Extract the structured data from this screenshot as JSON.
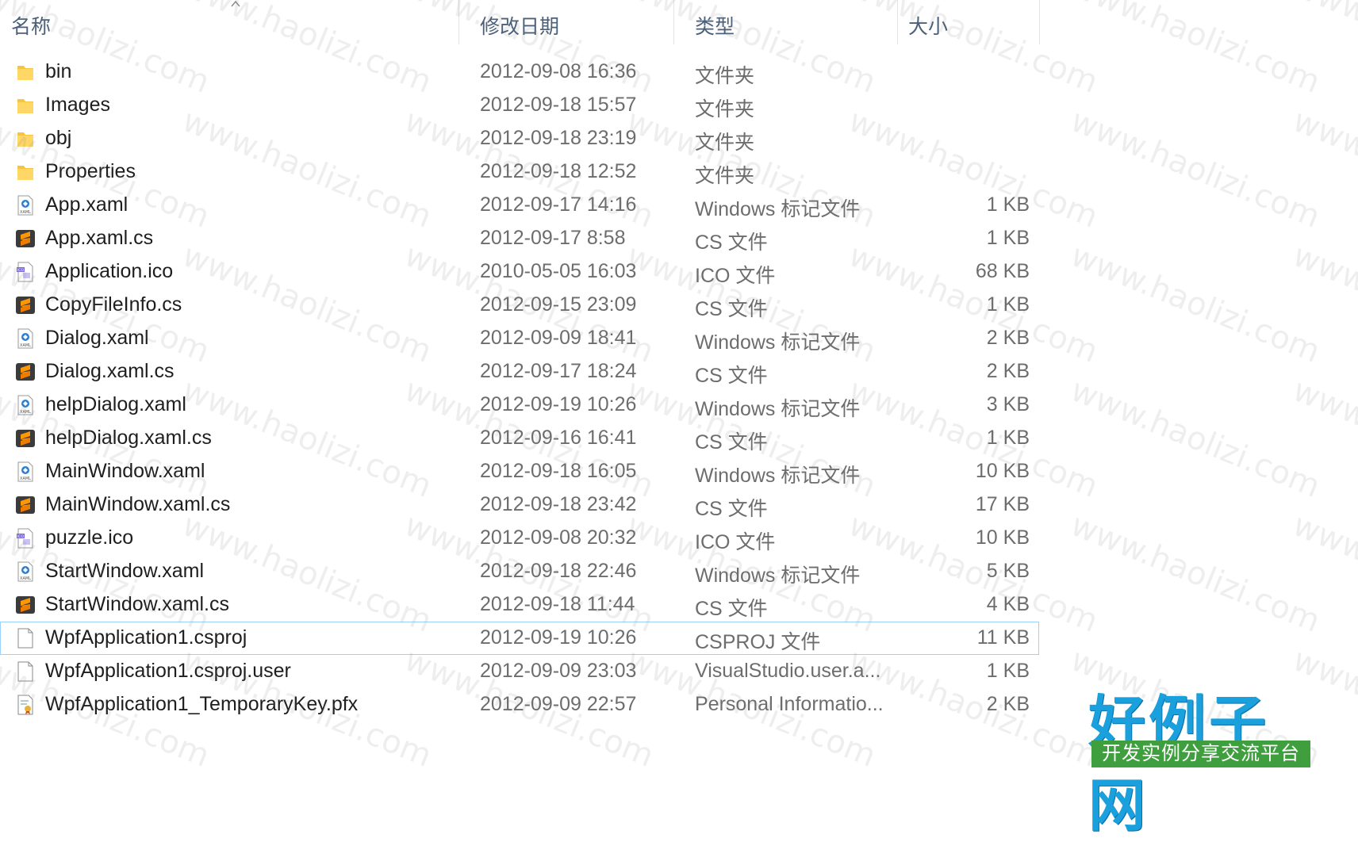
{
  "header": {
    "name_label": "名称",
    "date_label": "修改日期",
    "type_label": "类型",
    "size_label": "大小"
  },
  "files": [
    {
      "name": "bin",
      "date": "2012-09-08 16:36",
      "type": "文件夹",
      "size": "",
      "icon": "folder-icon"
    },
    {
      "name": "Images",
      "date": "2012-09-18 15:57",
      "type": "文件夹",
      "size": "",
      "icon": "folder-icon"
    },
    {
      "name": "obj",
      "date": "2012-09-18 23:19",
      "type": "文件夹",
      "size": "",
      "icon": "folder-icon"
    },
    {
      "name": "Properties",
      "date": "2012-09-18 12:52",
      "type": "文件夹",
      "size": "",
      "icon": "folder-icon"
    },
    {
      "name": "App.xaml",
      "date": "2012-09-17 14:16",
      "type": "Windows 标记文件",
      "size": "1 KB",
      "icon": "xaml-file-icon"
    },
    {
      "name": "App.xaml.cs",
      "date": "2012-09-17 8:58",
      "type": "CS 文件",
      "size": "1 KB",
      "icon": "sublime-cs-icon"
    },
    {
      "name": "Application.ico",
      "date": "2010-05-05 16:03",
      "type": "ICO 文件",
      "size": "68 KB",
      "icon": "ico-file-icon"
    },
    {
      "name": "CopyFileInfo.cs",
      "date": "2012-09-15 23:09",
      "type": "CS 文件",
      "size": "1 KB",
      "icon": "sublime-cs-icon"
    },
    {
      "name": "Dialog.xaml",
      "date": "2012-09-09 18:41",
      "type": "Windows 标记文件",
      "size": "2 KB",
      "icon": "xaml-file-icon"
    },
    {
      "name": "Dialog.xaml.cs",
      "date": "2012-09-17 18:24",
      "type": "CS 文件",
      "size": "2 KB",
      "icon": "sublime-cs-icon"
    },
    {
      "name": "helpDialog.xaml",
      "date": "2012-09-19 10:26",
      "type": "Windows 标记文件",
      "size": "3 KB",
      "icon": "xaml-file-icon"
    },
    {
      "name": "helpDialog.xaml.cs",
      "date": "2012-09-16 16:41",
      "type": "CS 文件",
      "size": "1 KB",
      "icon": "sublime-cs-icon"
    },
    {
      "name": "MainWindow.xaml",
      "date": "2012-09-18 16:05",
      "type": "Windows 标记文件",
      "size": "10 KB",
      "icon": "xaml-file-icon"
    },
    {
      "name": "MainWindow.xaml.cs",
      "date": "2012-09-18 23:42",
      "type": "CS 文件",
      "size": "17 KB",
      "icon": "sublime-cs-icon"
    },
    {
      "name": "puzzle.ico",
      "date": "2012-09-08 20:32",
      "type": "ICO 文件",
      "size": "10 KB",
      "icon": "ico-file-icon"
    },
    {
      "name": "StartWindow.xaml",
      "date": "2012-09-18 22:46",
      "type": "Windows 标记文件",
      "size": "5 KB",
      "icon": "xaml-file-icon"
    },
    {
      "name": "StartWindow.xaml.cs",
      "date": "2012-09-18 11:44",
      "type": "CS 文件",
      "size": "4 KB",
      "icon": "sublime-cs-icon"
    },
    {
      "name": "WpfApplication1.csproj",
      "date": "2012-09-19 10:26",
      "type": "CSPROJ 文件",
      "size": "11 KB",
      "icon": "blank-file-icon",
      "selected": true
    },
    {
      "name": "WpfApplication1.csproj.user",
      "date": "2012-09-09 23:03",
      "type": "VisualStudio.user.a...",
      "size": "1 KB",
      "icon": "blank-file-icon"
    },
    {
      "name": "WpfApplication1_TemporaryKey.pfx",
      "date": "2012-09-09 22:57",
      "type": "Personal Informatio...",
      "size": "2 KB",
      "icon": "certificate-file-icon"
    }
  ],
  "watermark": {
    "text": "www.haolizi.com",
    "logo_main": "好例子网",
    "logo_sub": "开发实例分享交流平台"
  },
  "colors": {
    "header_text": "#4c607a",
    "secondary_text": "#6d6d6d",
    "selection_border": "#99d1ff",
    "folder": "#f5c542",
    "logo_blue": "#1aa0dc",
    "logo_green": "#3f9f3f"
  }
}
